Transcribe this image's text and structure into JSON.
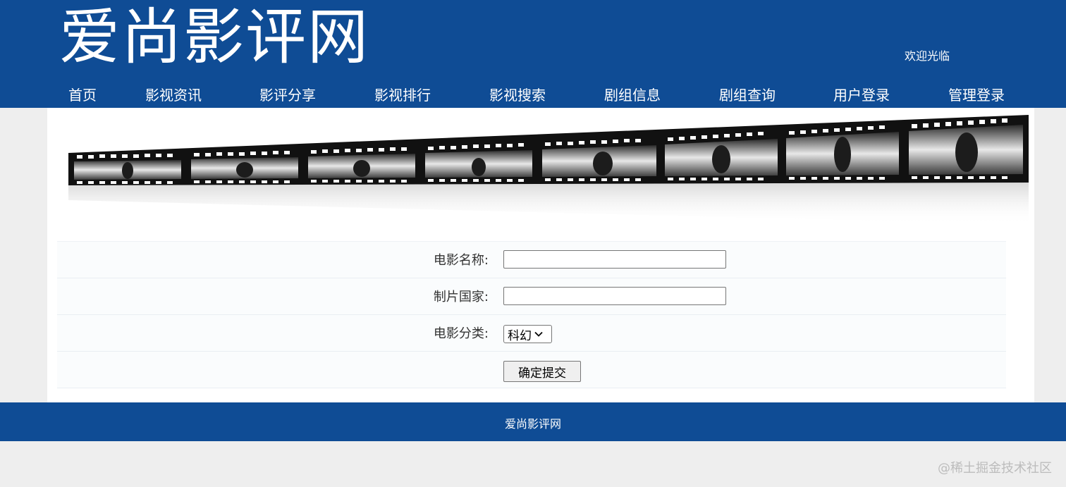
{
  "header": {
    "logo_text": "爱尚影评网",
    "welcome_text": "欢迎光临"
  },
  "nav": {
    "items": [
      {
        "label": "首页"
      },
      {
        "label": "影视资讯"
      },
      {
        "label": "影评分享"
      },
      {
        "label": "影视排行"
      },
      {
        "label": "影视搜索"
      },
      {
        "label": "剧组信息"
      },
      {
        "label": "剧组查询"
      },
      {
        "label": "用户登录"
      },
      {
        "label": "管理登录"
      }
    ]
  },
  "form": {
    "movie_name_label": "电影名称:",
    "movie_name_value": "",
    "country_label": "制片国家:",
    "country_value": "",
    "category_label": "电影分类:",
    "category_selected": "科幻",
    "submit_label": "确定提交"
  },
  "footer": {
    "text": "爱尚影评网"
  },
  "watermark": {
    "text": "@稀土掘金技术社区"
  },
  "colors": {
    "brand_blue": "#0f4c95",
    "page_bg": "#eeeeee"
  }
}
